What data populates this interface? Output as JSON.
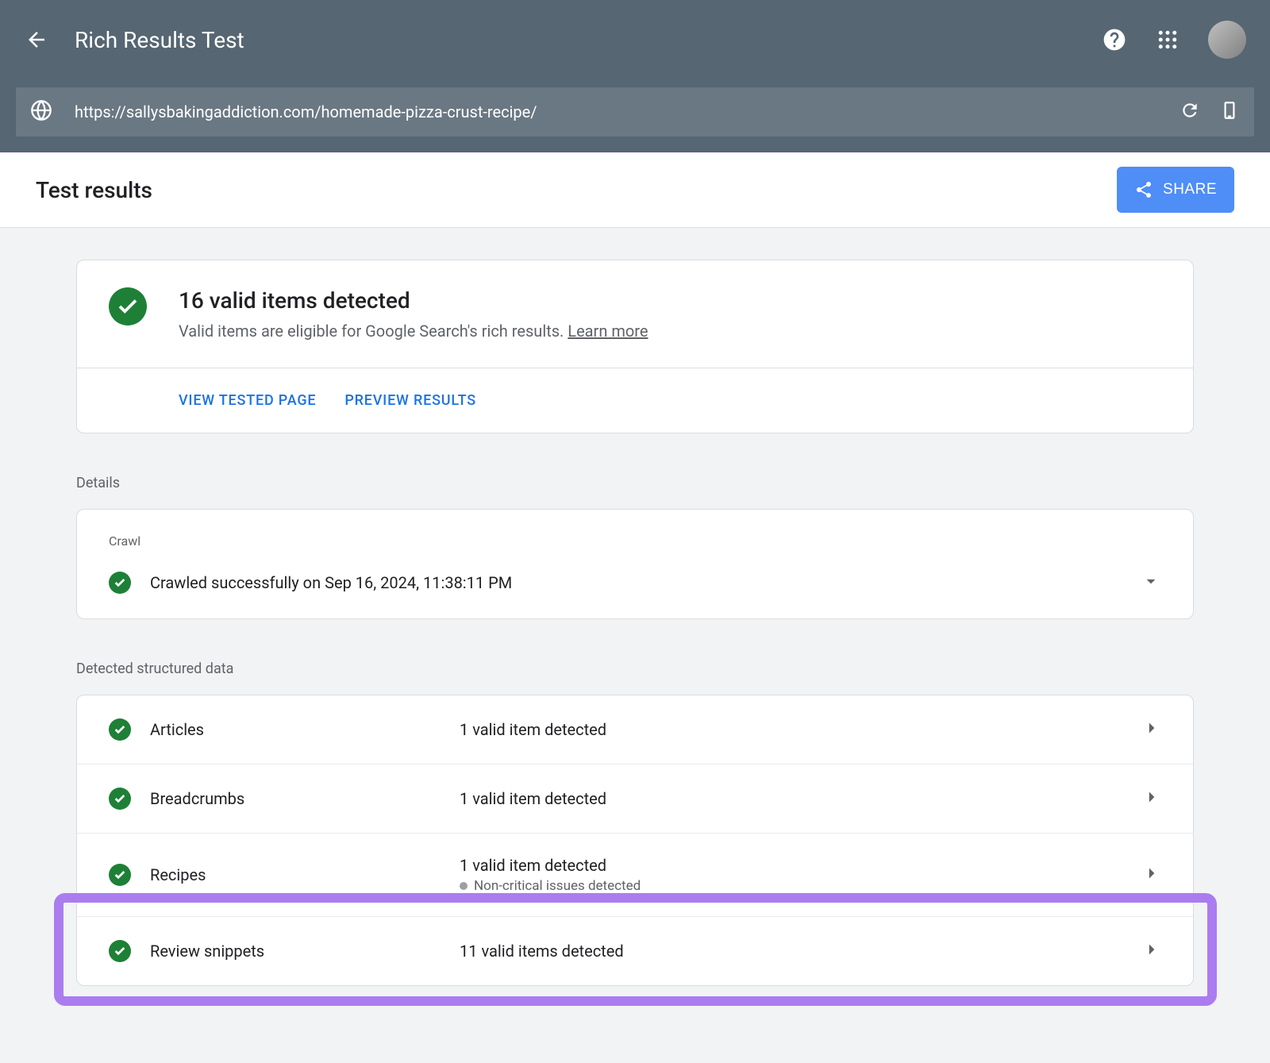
{
  "header": {
    "title": "Rich Results Test"
  },
  "url_bar": {
    "url": "https://sallysbakingaddiction.com/homemade-pizza-crust-recipe/"
  },
  "test_results": {
    "title": "Test results",
    "share_label": "SHARE"
  },
  "summary": {
    "heading": "16 valid items detected",
    "subtitle": "Valid items are eligible for Google Search's rich results. ",
    "learn_more": "Learn more",
    "view_tested": "VIEW TESTED PAGE",
    "preview_results": "PREVIEW RESULTS"
  },
  "details": {
    "section_label": "Details",
    "crawl_label": "Crawl",
    "crawl_text": "Crawled successfully on Sep 16, 2024, 11:38:11 PM"
  },
  "structured": {
    "section_label": "Detected structured data",
    "rows": [
      {
        "name": "Articles",
        "status": "1 valid item detected",
        "note": ""
      },
      {
        "name": "Breadcrumbs",
        "status": "1 valid item detected",
        "note": ""
      },
      {
        "name": "Recipes",
        "status": "1 valid item detected",
        "note": "Non-critical issues detected"
      },
      {
        "name": "Review snippets",
        "status": "11 valid items detected",
        "note": ""
      }
    ]
  }
}
